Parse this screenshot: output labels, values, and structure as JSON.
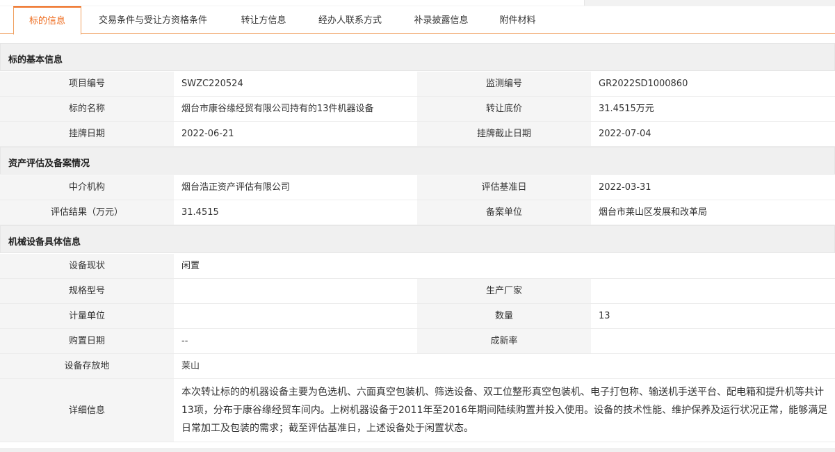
{
  "tabs": [
    {
      "label": "标的信息"
    },
    {
      "label": "交易条件与受让方资格条件"
    },
    {
      "label": "转让方信息"
    },
    {
      "label": "经办人联系方式"
    },
    {
      "label": "补录披露信息"
    },
    {
      "label": "附件材料"
    }
  ],
  "basic": {
    "title": "标的基本信息",
    "project_no_label": "项目编号",
    "project_no": "SWZC220524",
    "monitor_no_label": "监测编号",
    "monitor_no": "GR2022SD1000860",
    "name_label": "标的名称",
    "name": "烟台市康谷缘经贸有限公司持有的13件机器设备",
    "price_label": "转让底价",
    "price": "31.4515万元",
    "list_date_label": "挂牌日期",
    "list_date": "2022-06-21",
    "end_date_label": "挂牌截止日期",
    "end_date": "2022-07-04"
  },
  "assessment": {
    "title": "资产评估及备案情况",
    "agency_label": "中介机构",
    "agency": "烟台浩正资产评估有限公司",
    "base_date_label": "评估基准日",
    "base_date": "2022-03-31",
    "result_label": "评估结果（万元）",
    "result": "31.4515",
    "filing_label": "备案单位",
    "filing": "烟台市莱山区发展和改革局"
  },
  "equipment": {
    "title": "机械设备具体信息",
    "status_label": "设备现状",
    "status": "闲置",
    "model_label": "规格型号",
    "model": "",
    "maker_label": "生产厂家",
    "maker": "",
    "unit_label": "计量单位",
    "unit": "",
    "qty_label": "数量",
    "qty": "13",
    "buy_date_label": "购置日期",
    "buy_date": "--",
    "newness_label": "成新率",
    "newness": "",
    "location_label": "设备存放地",
    "location": "莱山",
    "detail_label": "详细信息",
    "detail": "本次转让标的的机器设备主要为色选机、六面真空包装机、筛选设备、双工位整形真空包装机、电子打包称、输送机手送平台、配电箱和提升机等共计13项，分布于康谷缘经贸车间内。上树机器设备于2011年至2016年期间陆续购置并投入使用。设备的技术性能、维护保养及运行状况正常，能够满足日常加工及包装的需求；截至评估基准日，上述设备处于闲置状态。"
  }
}
